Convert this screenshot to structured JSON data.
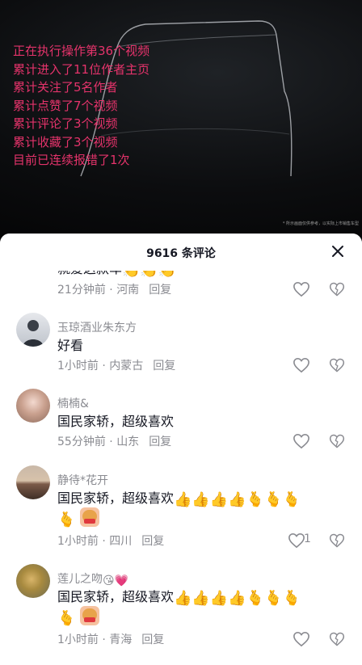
{
  "overlay": {
    "lines": [
      "正在执行操作第36个视频",
      "累计进入了11位作者主页",
      "累计关注了5名作者",
      "累计点赞了7个视频",
      "累计评论了3个视频",
      "累计收藏了3个视频",
      "目前已连续报错了1次"
    ]
  },
  "video": {
    "disclaimer": "* 所示画面仅供参考，以实际上市销售车型"
  },
  "sheet": {
    "title": "9616 条评论"
  },
  "comments": [
    {
      "text": "就爱这款车",
      "emojis": "👏👏👏",
      "time": "21分钟前",
      "location": "河南",
      "reply": "回复"
    },
    {
      "name": "玉琼酒业朱东方",
      "text": "好看",
      "time": "1小时前",
      "location": "内蒙古",
      "reply": "回复"
    },
    {
      "name": "楠楠&",
      "text": "国民家轿，超级喜欢",
      "time": "55分钟前",
      "location": "山东",
      "reply": "回复"
    },
    {
      "name": "静待*花开",
      "text": "国民家轿，超级喜欢",
      "emojis": "👍👍👍👍🫰🫰🫰",
      "emojis2": "🫰",
      "time": "1小时前",
      "location": "四川",
      "reply": "回复",
      "likes": "1"
    },
    {
      "name": "莲儿之吻",
      "name_emojis": "😘💗",
      "text": "国民家轿，超级喜欢",
      "emojis": "👍👍👍👍🫰🫰🫰",
      "emojis2": "🫰",
      "time": "1小时前",
      "location": "青海",
      "reply": "回复"
    }
  ]
}
